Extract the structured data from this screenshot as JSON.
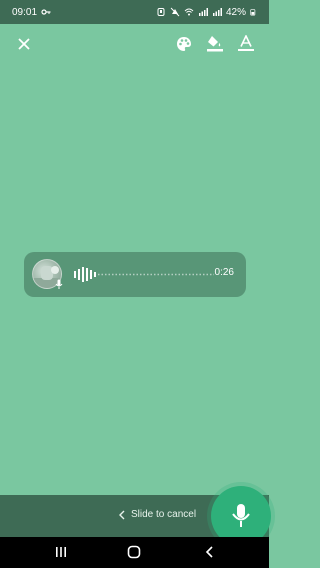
{
  "status_bar": {
    "time": "09:01",
    "battery": "42%",
    "icons": [
      "key-icon",
      "alarm-icon",
      "notifications-off-icon",
      "wifi-icon",
      "signal-icon",
      "signal-icon",
      "battery-icon"
    ]
  },
  "toolbar": {
    "close_icon": "close-icon",
    "palette_icon": "palette-icon",
    "fill_icon": "fill-color-icon",
    "text_icon": "text-format-icon"
  },
  "voice_message": {
    "duration": "0:26",
    "avatar_icon": "avatar"
  },
  "bottom": {
    "slide_text": "Slide to cancel"
  },
  "colors": {
    "background": "#7ac7a0",
    "bar": "#3e6b55",
    "accent": "#2eb07a"
  }
}
